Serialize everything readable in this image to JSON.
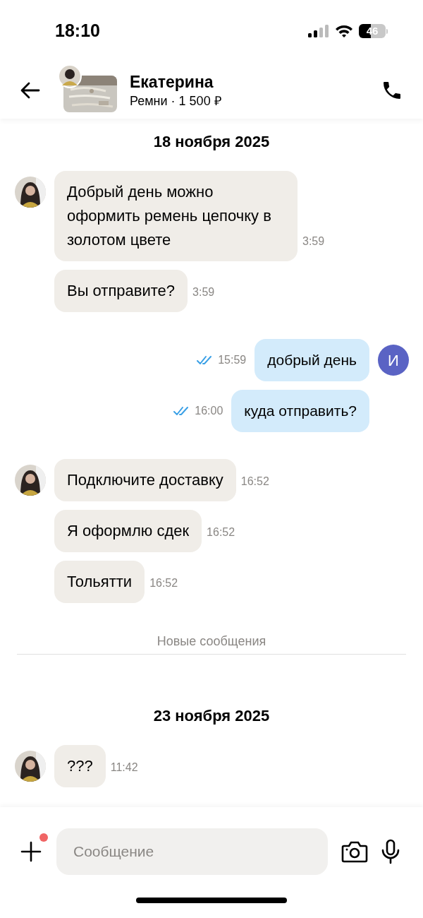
{
  "status_bar": {
    "time": "18:10",
    "battery": "46"
  },
  "header": {
    "name": "Екатерина",
    "subtitle": "Ремни · 1 500 ₽"
  },
  "messages": [
    {
      "kind": "date",
      "text": "18 ноября 2025"
    },
    {
      "kind": "incoming",
      "avatar": true,
      "text": "Добрый день можно оформить ремень цепочку в золотом цвете",
      "time": "3:59"
    },
    {
      "kind": "incoming",
      "avatar": false,
      "text": "Вы отправите?",
      "time": "3:59"
    },
    {
      "kind": "outgoing",
      "avatar": "И",
      "read": true,
      "text": "добрый день",
      "time": "15:59"
    },
    {
      "kind": "outgoing",
      "read": true,
      "text": "куда отправить?",
      "time": "16:00"
    },
    {
      "kind": "incoming",
      "avatar": true,
      "text": "Подключите доставку",
      "time": "16:52"
    },
    {
      "kind": "incoming",
      "avatar": false,
      "text": "Я оформлю сдек",
      "time": "16:52"
    },
    {
      "kind": "incoming",
      "avatar": false,
      "text": "Тольятти",
      "time": "16:52"
    },
    {
      "kind": "divider",
      "text": "Новые сообщения"
    },
    {
      "kind": "date",
      "text": "23 ноября 2025"
    },
    {
      "kind": "incoming",
      "avatar": true,
      "text": "???",
      "time": "11:42"
    }
  ],
  "composer": {
    "placeholder": "Сообщение",
    "attach_badge": true
  }
}
